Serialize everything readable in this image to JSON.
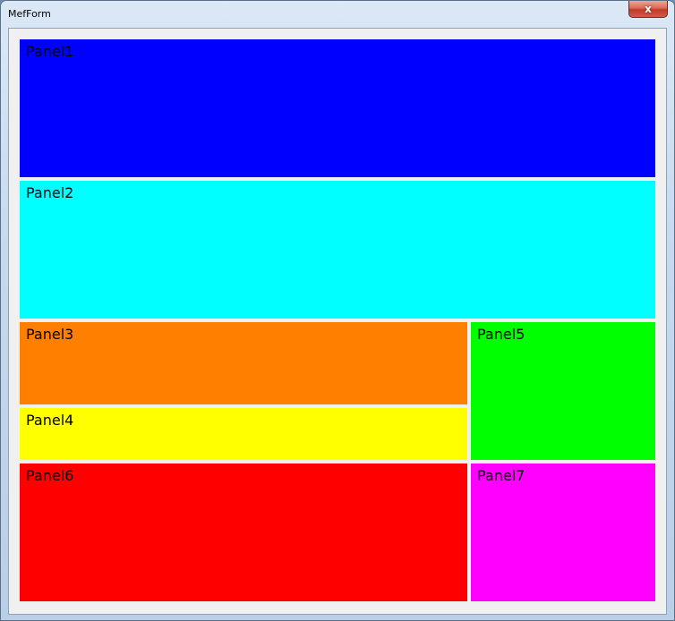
{
  "window": {
    "title": "MefForm",
    "close_symbol": "x"
  },
  "panels": [
    {
      "label": "Panel1",
      "color": "#0000ff"
    },
    {
      "label": "Panel2",
      "color": "#00ffff"
    },
    {
      "label": "Panel3",
      "color": "#ff8000"
    },
    {
      "label": "Panel4",
      "color": "#ffff00"
    },
    {
      "label": "Panel5",
      "color": "#00ff00"
    },
    {
      "label": "Panel6",
      "color": "#ff0000"
    },
    {
      "label": "Panel7",
      "color": "#ff00ff"
    }
  ]
}
